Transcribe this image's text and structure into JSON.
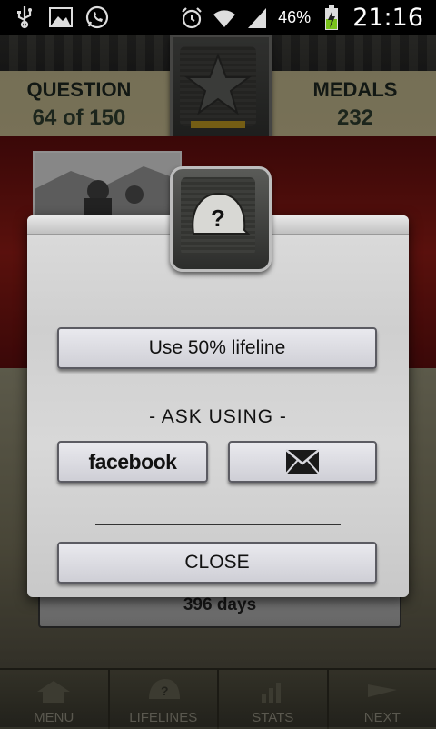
{
  "status_bar": {
    "battery_percent": "46%",
    "time": "21:16",
    "left_icons": [
      "usb-icon",
      "image-icon",
      "whatsapp-icon"
    ],
    "right_icons": [
      "alarm-icon",
      "wifi-icon",
      "signal-icon",
      "battery-charging-icon"
    ]
  },
  "header": {
    "question_label": "QUESTION",
    "question_value": "64 of 150",
    "medals_label": "MEDALS",
    "medals_value": "232",
    "rank_icon": "star-icon"
  },
  "background": {
    "days_text": "396 days"
  },
  "dialog": {
    "icon": "helmet-question-icon",
    "lifeline_label": "Use 50% lifeline",
    "ask_using_label": "- ASK USING -",
    "facebook_label": "facebook",
    "mail_icon": "envelope-icon",
    "close_label": "CLOSE"
  },
  "bottom_nav": {
    "items": [
      {
        "label": "MENU",
        "icon": "home-icon"
      },
      {
        "label": "LIFELINES",
        "icon": "helmet-question-icon"
      },
      {
        "label": "STATS",
        "icon": "bar-chart-icon"
      },
      {
        "label": "NEXT",
        "icon": "arrow-right-icon"
      }
    ]
  },
  "colors": {
    "header_tan": "#b8ae86",
    "red_band": "#8a1a14",
    "badge_gold": "#b3901f",
    "dialog_bg": "#d8d8d8"
  }
}
